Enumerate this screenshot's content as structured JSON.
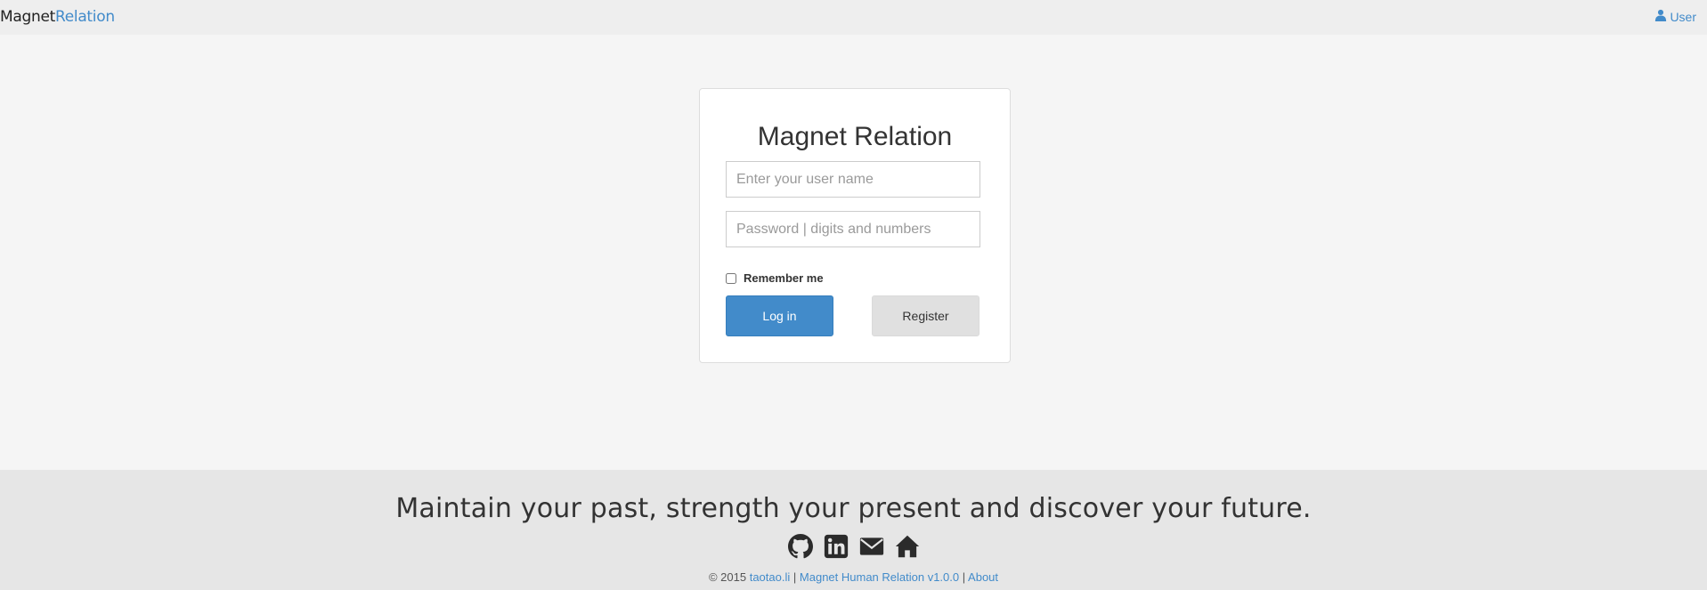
{
  "navbar": {
    "brand_part1": "Magnet",
    "brand_part2": "Relation",
    "user_label": "User",
    "user_icon": "user-icon"
  },
  "login": {
    "title": "Magnet Relation",
    "username_placeholder": "Enter your user name",
    "username_value": "",
    "password_placeholder": "Password | digits and numbers",
    "password_value": "",
    "remember_label": "Remember me",
    "remember_checked": false,
    "login_label": "Log in",
    "register_label": "Register"
  },
  "footer": {
    "slogan": "Maintain your past, strength your present and discover your future.",
    "social_icons": [
      "github-icon",
      "linkedin-icon",
      "envelope-icon",
      "home-icon"
    ],
    "copyright_prefix": "© 2015",
    "link_site": "taotao.li",
    "separator": "|",
    "link_app": "Magnet Human Relation v1.0.0",
    "link_about": "About"
  },
  "colors": {
    "accent": "#428bca",
    "page_bg": "#f5f5f5",
    "footer_bg": "#e6e6e6"
  }
}
